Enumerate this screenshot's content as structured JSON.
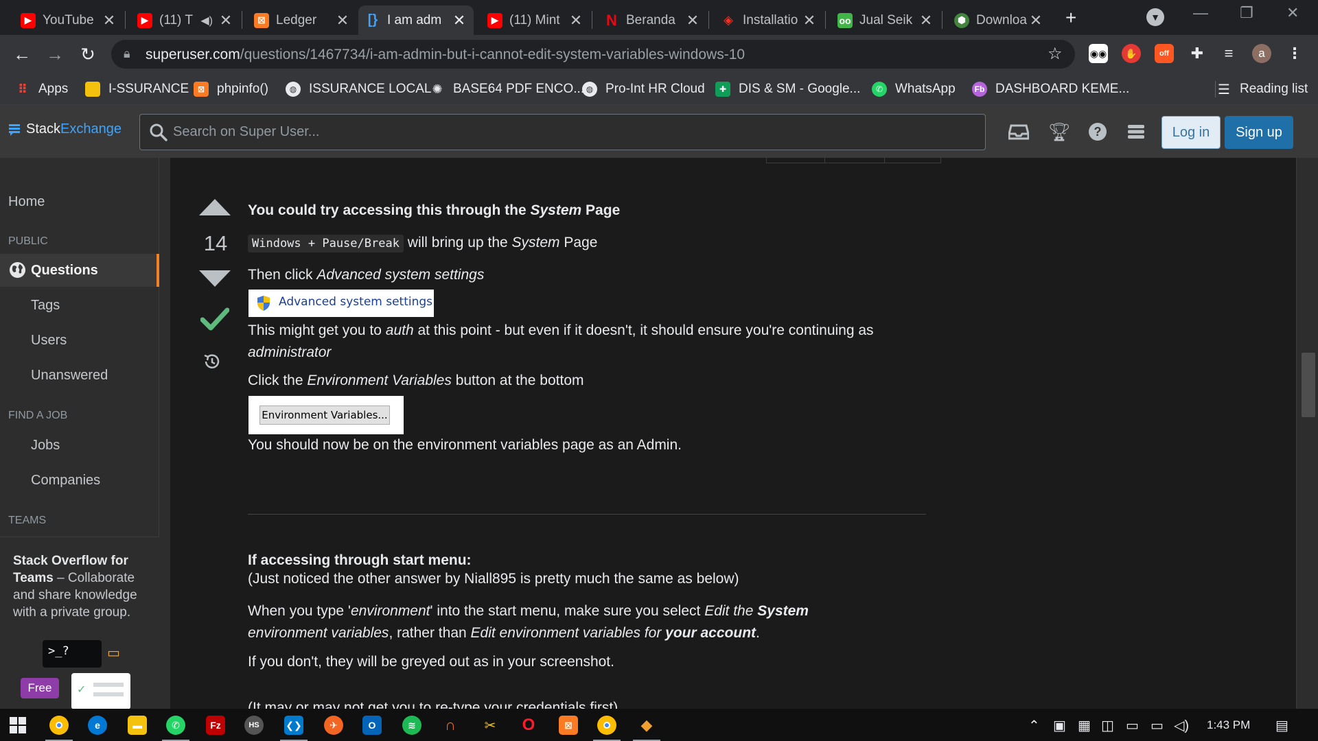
{
  "browser": {
    "tabs": [
      {
        "title": "YouTube",
        "icon": "youtube-icon",
        "active": false
      },
      {
        "title": "(11) T",
        "icon": "youtube-icon",
        "active": false
      },
      {
        "title": "Ledger",
        "icon": "xampp-icon",
        "active": false
      },
      {
        "title": "I am adm",
        "icon": "stackexchange-icon",
        "active": true
      },
      {
        "title": "(11) Mint",
        "icon": "youtube-icon",
        "active": false
      },
      {
        "title": "Beranda",
        "icon": "netflix-icon",
        "active": false
      },
      {
        "title": "Installatio",
        "icon": "laravel-icon",
        "active": false
      },
      {
        "title": "Jual Seik",
        "icon": "tokopedia-icon",
        "active": false
      },
      {
        "title": "Downloa",
        "icon": "nodejs-icon",
        "active": false
      }
    ],
    "new_tab_label": "+",
    "url_host": "superuser.com",
    "url_path": "/questions/1467734/i-am-admin-but-i-cannot-edit-system-variables-windows-10",
    "profile_letter": "a",
    "ext_badge": "off",
    "bookmarks": [
      {
        "label": "Apps",
        "icon": "apps-grid-icon",
        "color": "#ea4335"
      },
      {
        "label": "I-SSURANCE",
        "icon": "folder-icon",
        "color": "#f4c20d"
      },
      {
        "label": "phpinfo()",
        "icon": "xampp-icon",
        "color": "#fb7a24"
      },
      {
        "label": "ISSURANCE LOCAL",
        "icon": "globe-icon",
        "color": "#e8eaed"
      },
      {
        "label": "BASE64 PDF ENCO...",
        "icon": "base64-icon",
        "color": "#e8eaed"
      },
      {
        "label": "Pro-Int HR Cloud",
        "icon": "globe-icon",
        "color": "#e8eaed"
      },
      {
        "label": "DIS & SM - Google...",
        "icon": "sheets-icon",
        "color": "#0f9d58"
      },
      {
        "label": "WhatsApp",
        "icon": "whatsapp-icon",
        "color": "#25d366"
      },
      {
        "label": "DASHBOARD KEME...",
        "icon": "dashboard-icon",
        "color": "#b565d9"
      }
    ],
    "reading_list_label": "Reading list"
  },
  "site": {
    "logo_stack": "Stack",
    "logo_exchange": "Exchange",
    "search_placeholder": "Search on Super User...",
    "login_label": "Log in",
    "signup_label": "Sign up"
  },
  "nav": {
    "home": "Home",
    "public_section": "PUBLIC",
    "questions": "Questions",
    "tags": "Tags",
    "users": "Users",
    "unanswered": "Unanswered",
    "find_job_section": "FIND A JOB",
    "jobs": "Jobs",
    "companies": "Companies",
    "teams_section": "TEAMS",
    "teams_title_1": "Stack Overflow for",
    "teams_title_2": "Teams",
    "teams_desc": " – Collaborate and share knowledge with a private group.",
    "free_badge": "Free",
    "terminal_prompt": ">_?"
  },
  "answer": {
    "vote_count": "14",
    "p1_pre": "You could try accessing this through the ",
    "p1_em": "System",
    "p1_post": " Page",
    "p2_code": "Windows + Pause/Break",
    "p2_mid": " will bring up the ",
    "p2_em": "System",
    "p2_post": " Page",
    "p3_pre": "Then click ",
    "p3_em": "Advanced system settings",
    "shot1_label": "Advanced system settings",
    "p4_pre": "This might get you to ",
    "p4_em1": "auth",
    "p4_mid": " at this point - but even if it doesn't, it should ensure you're continuing as ",
    "p4_em2": "administrator",
    "p5_pre": "Click the ",
    "p5_em": "Environment Variables",
    "p5_post": " button at the bottom",
    "shot2_label": "Environment Variables...",
    "p6": "You should now be on the environment variables page as an Admin.",
    "h2": "If accessing through start menu:",
    "p7": "(Just noticed the other answer by Niall895 is pretty much the same as below)",
    "p8_pre": "When you type '",
    "p8_em1": "environment",
    "p8_mid1": "' into the start menu, make sure you select ",
    "p8_em2": "Edit the ",
    "p8_strong1": "System",
    "p8_em3": " environment variables",
    "p8_mid2": ", rather than ",
    "p8_em4": "Edit environment variables for ",
    "p8_strong2": "your account",
    "p8_post": ".",
    "p9": "If you don't, they will be greyed out as in your screenshot.",
    "p10": "(It may or may not get you to re-type your credentials first)"
  },
  "taskbar": {
    "clock": "1:43 PM"
  },
  "colors": {
    "accent_blue": "#0a95ff",
    "accept_green": "#5eba7d",
    "nav_active_orange": "#f48225"
  }
}
